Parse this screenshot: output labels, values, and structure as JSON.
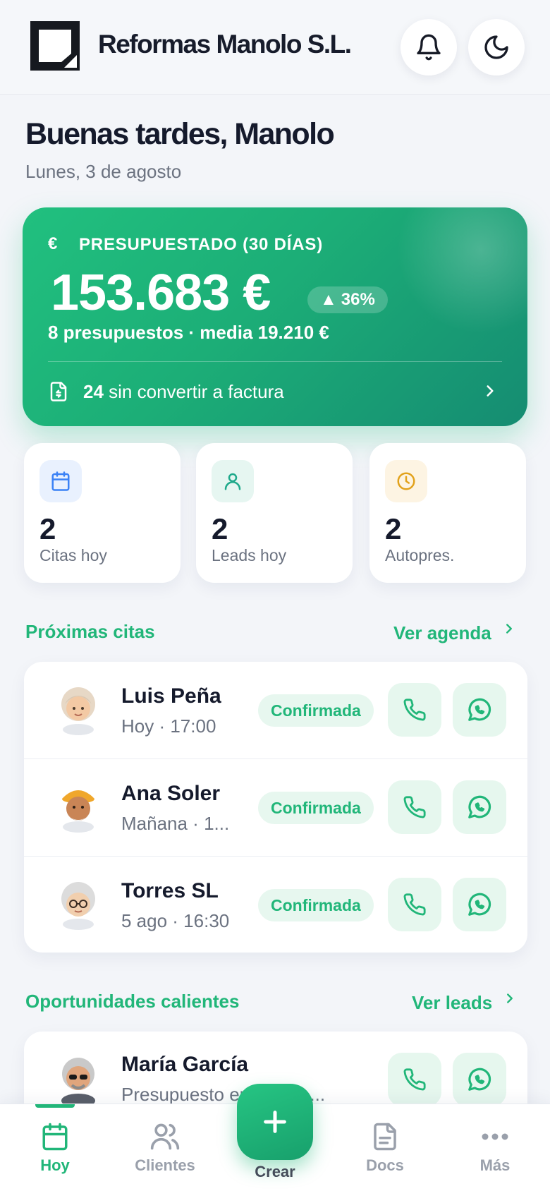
{
  "header": {
    "brand": "Reformas Manolo S.L."
  },
  "greeting": {
    "title": "Buenas tardes, Manolo",
    "date": "Lunes, 3 de agosto"
  },
  "summary": {
    "label": "PRESUPUESTADO (30 DÍAS)",
    "amount": "153.683 €",
    "trend": "36%",
    "detail": "8 presupuestos · media 19.210 €",
    "pending_count": "24",
    "pending_text": "sin convertir a factura"
  },
  "stats": [
    {
      "value": "2",
      "label": "Citas hoy",
      "icon": "calendar-icon",
      "color": "#3b82f6",
      "bg": "#e9f1fe"
    },
    {
      "value": "2",
      "label": "Leads hoy",
      "icon": "user-icon",
      "color": "#1fa98b",
      "bg": "#e6f6f1"
    },
    {
      "value": "2",
      "label": "Autopres.",
      "icon": "clock-icon",
      "color": "#e2a21c",
      "bg": "#fdf4e3"
    }
  ],
  "appointments": {
    "title": "Próximas citas",
    "link": "Ver agenda",
    "items": [
      {
        "name": "Luis Peña",
        "when": "Hoy · 17:00",
        "status": "Confirmada"
      },
      {
        "name": "Ana Soler",
        "when": "Mañana · 1...",
        "status": "Confirmada"
      },
      {
        "name": "Torres SL",
        "when": "5 ago · 16:30",
        "status": "Confirmada"
      }
    ]
  },
  "opportunities": {
    "title": "Oportunidades calientes",
    "link": "Ver leads",
    "items": [
      {
        "name": "María García",
        "detail": "Presupuesto enviado · ..."
      }
    ]
  },
  "nav": {
    "items": [
      "Hoy",
      "Clientes",
      "Crear",
      "Docs",
      "Más"
    ]
  },
  "colors": {
    "accent": "#21b679",
    "background": "#f3f5f9"
  }
}
